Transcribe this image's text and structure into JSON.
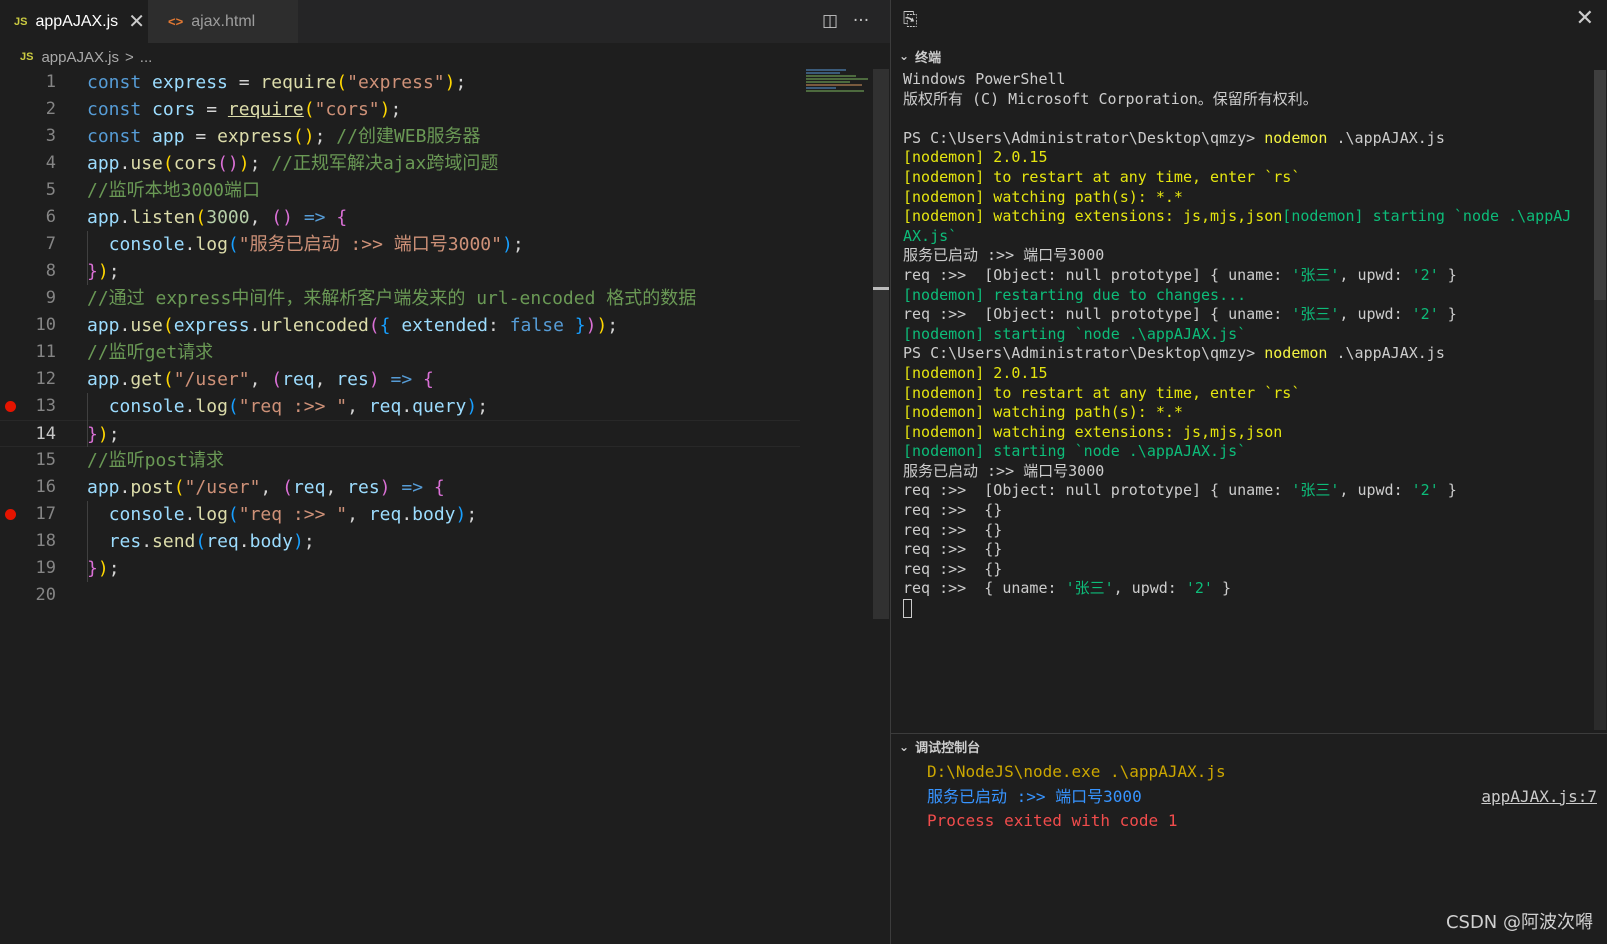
{
  "tabs": [
    {
      "icon": "JS",
      "label": "appAJAX.js",
      "close": "✕"
    },
    {
      "icon": "<>",
      "label": "ajax.html"
    }
  ],
  "editor_actions": {
    "split": "◫",
    "more": "···"
  },
  "breadcrumb": {
    "icon": "JS",
    "file": "appAJAX.js",
    "sep": ">",
    "rest": "..."
  },
  "code": {
    "current_line": 14,
    "breakpoints": [
      13,
      17
    ],
    "lines": [
      [
        [
          "k",
          "const "
        ],
        [
          "v",
          "express"
        ],
        [
          "p",
          " = "
        ],
        [
          "f",
          "require"
        ],
        [
          "b1",
          "("
        ],
        [
          "s",
          "\"express\""
        ],
        [
          "b1",
          ")"
        ],
        [
          "p",
          ";"
        ]
      ],
      [
        [
          "k",
          "const "
        ],
        [
          "v",
          "cors"
        ],
        [
          "p",
          " = "
        ],
        [
          "f u",
          "require"
        ],
        [
          "b1",
          "("
        ],
        [
          "s",
          "\"cors\""
        ],
        [
          "b1",
          ")"
        ],
        [
          "p",
          ";"
        ]
      ],
      [
        [
          "k",
          "const "
        ],
        [
          "v",
          "app"
        ],
        [
          "p",
          " = "
        ],
        [
          "f",
          "express"
        ],
        [
          "b1",
          "()"
        ],
        [
          "p",
          "; "
        ],
        [
          "c",
          "//创建WEB服务器"
        ]
      ],
      [
        [
          "v",
          "app"
        ],
        [
          "p",
          "."
        ],
        [
          "f",
          "use"
        ],
        [
          "b1",
          "("
        ],
        [
          "f",
          "cors"
        ],
        [
          "b2",
          "()"
        ],
        [
          "b1",
          ")"
        ],
        [
          "p",
          "; "
        ],
        [
          "c",
          "//正规军解决ajax跨域问题"
        ]
      ],
      [
        [
          "c",
          "//监听本地3000端口"
        ]
      ],
      [
        [
          "v",
          "app"
        ],
        [
          "p",
          "."
        ],
        [
          "f",
          "listen"
        ],
        [
          "b1",
          "("
        ],
        [
          "n",
          "3000"
        ],
        [
          "p",
          ", "
        ],
        [
          "b2",
          "()"
        ],
        [
          "p",
          " "
        ],
        [
          "k",
          "=>"
        ],
        [
          "p",
          " "
        ],
        [
          "b2",
          "{"
        ]
      ],
      [
        [
          "p",
          "  "
        ],
        [
          "v",
          "console"
        ],
        [
          "p",
          "."
        ],
        [
          "f",
          "log"
        ],
        [
          "b3",
          "("
        ],
        [
          "s",
          "\"服务已启动 :>> 端口号3000\""
        ],
        [
          "b3",
          ")"
        ],
        [
          "p",
          ";"
        ]
      ],
      [
        [
          "b2",
          "}"
        ],
        [
          "b1",
          ")"
        ],
        [
          "p",
          ";"
        ]
      ],
      [
        [
          "c",
          "//通过 express中间件，来解析客户端发来的 url-encoded 格式的数据"
        ]
      ],
      [
        [
          "v",
          "app"
        ],
        [
          "p",
          "."
        ],
        [
          "f",
          "use"
        ],
        [
          "b1",
          "("
        ],
        [
          "v",
          "express"
        ],
        [
          "p",
          "."
        ],
        [
          "f",
          "urlencoded"
        ],
        [
          "b2",
          "("
        ],
        [
          "b3",
          "{"
        ],
        [
          "p",
          " "
        ],
        [
          "v",
          "extended"
        ],
        [
          "p",
          ": "
        ],
        [
          "k",
          "false"
        ],
        [
          "p",
          " "
        ],
        [
          "b3",
          "}"
        ],
        [
          "b2",
          ")"
        ],
        [
          "b1",
          ")"
        ],
        [
          "p",
          ";"
        ]
      ],
      [
        [
          "c",
          "//监听get请求"
        ]
      ],
      [
        [
          "v",
          "app"
        ],
        [
          "p",
          "."
        ],
        [
          "f",
          "get"
        ],
        [
          "b1",
          "("
        ],
        [
          "s",
          "\"/user\""
        ],
        [
          "p",
          ", "
        ],
        [
          "b2",
          "("
        ],
        [
          "v",
          "req"
        ],
        [
          "p",
          ", "
        ],
        [
          "v",
          "res"
        ],
        [
          "b2",
          ")"
        ],
        [
          "p",
          " "
        ],
        [
          "k",
          "=>"
        ],
        [
          "p",
          " "
        ],
        [
          "b2",
          "{"
        ]
      ],
      [
        [
          "p",
          "  "
        ],
        [
          "v",
          "console"
        ],
        [
          "p",
          "."
        ],
        [
          "f",
          "log"
        ],
        [
          "b3",
          "("
        ],
        [
          "s",
          "\"req :>> \""
        ],
        [
          "p",
          ", "
        ],
        [
          "v",
          "req"
        ],
        [
          "p",
          "."
        ],
        [
          "v",
          "query"
        ],
        [
          "b3",
          ")"
        ],
        [
          "p",
          ";"
        ]
      ],
      [
        [
          "b2",
          "}"
        ],
        [
          "b1",
          ")"
        ],
        [
          "p",
          ";"
        ]
      ],
      [
        [
          "c",
          "//监听post请求"
        ]
      ],
      [
        [
          "v",
          "app"
        ],
        [
          "p",
          "."
        ],
        [
          "f",
          "post"
        ],
        [
          "b1",
          "("
        ],
        [
          "s",
          "\"/user\""
        ],
        [
          "p",
          ", "
        ],
        [
          "b2",
          "("
        ],
        [
          "v",
          "req"
        ],
        [
          "p",
          ", "
        ],
        [
          "v",
          "res"
        ],
        [
          "b2",
          ")"
        ],
        [
          "p",
          " "
        ],
        [
          "k",
          "=>"
        ],
        [
          "p",
          " "
        ],
        [
          "b2",
          "{"
        ]
      ],
      [
        [
          "p",
          "  "
        ],
        [
          "v",
          "console"
        ],
        [
          "p",
          "."
        ],
        [
          "f",
          "log"
        ],
        [
          "b3",
          "("
        ],
        [
          "s",
          "\"req :>> \""
        ],
        [
          "p",
          ", "
        ],
        [
          "v",
          "req"
        ],
        [
          "p",
          "."
        ],
        [
          "v",
          "body"
        ],
        [
          "b3",
          ")"
        ],
        [
          "p",
          ";"
        ]
      ],
      [
        [
          "p",
          "  "
        ],
        [
          "v",
          "res"
        ],
        [
          "p",
          "."
        ],
        [
          "f",
          "send"
        ],
        [
          "b3",
          "("
        ],
        [
          "v",
          "req"
        ],
        [
          "p",
          "."
        ],
        [
          "v",
          "body"
        ],
        [
          "b3",
          ")"
        ],
        [
          "p",
          ";"
        ]
      ],
      [
        [
          "b2",
          "}"
        ],
        [
          "b1",
          ")"
        ],
        [
          "p",
          ";"
        ]
      ],
      []
    ]
  },
  "panel": {
    "terminal_title": "终端",
    "debug_title": "调试控制台",
    "close": "✕"
  },
  "terminal_lines": [
    [
      [
        "t-def",
        "Windows PowerShell"
      ]
    ],
    [
      [
        "t-def",
        "版权所有 (C) Microsoft Corporation。保留所有权利。"
      ]
    ],
    [],
    [
      [
        "t-def",
        "PS C:\\Users\\Administrator\\Desktop\\qmzy> "
      ],
      [
        "t-y2",
        "nodemon"
      ],
      [
        "t-def",
        " .\\appAJAX.js"
      ]
    ],
    [
      [
        "t-y",
        "[nodemon] 2.0.15"
      ]
    ],
    [
      [
        "t-y",
        "[nodemon] to restart at any time, enter `rs`"
      ]
    ],
    [
      [
        "t-y",
        "[nodemon] watching path(s): *.*"
      ]
    ],
    [
      [
        "t-y",
        "[nodemon] watching extensions: js,mjs,json"
      ],
      [
        "t-g",
        "[nodemon] starting `node .\\appAJ"
      ]
    ],
    [
      [
        "t-g",
        "AX.js`"
      ]
    ],
    [
      [
        "t-def",
        "服务已启动 :>> 端口号3000"
      ]
    ],
    [
      [
        "t-def",
        "req :>>  [Object: null prototype] { uname: "
      ],
      [
        "t-g",
        "'张三'"
      ],
      [
        "t-def",
        ", upwd: "
      ],
      [
        "t-g",
        "'2'"
      ],
      [
        "t-def",
        " }"
      ]
    ],
    [
      [
        "t-g",
        "[nodemon] restarting due to changes..."
      ]
    ],
    [
      [
        "t-def",
        "req :>>  [Object: null prototype] { uname: "
      ],
      [
        "t-g",
        "'张三'"
      ],
      [
        "t-def",
        ", upwd: "
      ],
      [
        "t-g",
        "'2'"
      ],
      [
        "t-def",
        " }"
      ]
    ],
    [
      [
        "t-g",
        "[nodemon] starting `node .\\appAJAX.js`"
      ]
    ],
    [
      [
        "t-def",
        "PS C:\\Users\\Administrator\\Desktop\\qmzy> "
      ],
      [
        "t-y2",
        "nodemon"
      ],
      [
        "t-def",
        " .\\appAJAX.js"
      ]
    ],
    [
      [
        "t-y",
        "[nodemon] 2.0.15"
      ]
    ],
    [
      [
        "t-y",
        "[nodemon] to restart at any time, enter `rs`"
      ]
    ],
    [
      [
        "t-y",
        "[nodemon] watching path(s): *.*"
      ]
    ],
    [
      [
        "t-y",
        "[nodemon] watching extensions: js,mjs,json"
      ]
    ],
    [
      [
        "t-g",
        "[nodemon] starting `node .\\appAJAX.js`"
      ]
    ],
    [
      [
        "t-def",
        "服务已启动 :>> 端口号3000"
      ]
    ],
    [
      [
        "t-def",
        "req :>>  [Object: null prototype] { uname: "
      ],
      [
        "t-g",
        "'张三'"
      ],
      [
        "t-def",
        ", upwd: "
      ],
      [
        "t-g",
        "'2'"
      ],
      [
        "t-def",
        " }"
      ]
    ],
    [
      [
        "t-def",
        "req :>>  {}"
      ]
    ],
    [
      [
        "t-def",
        "req :>>  {}"
      ]
    ],
    [
      [
        "t-def",
        "req :>>  {}"
      ]
    ],
    [
      [
        "t-def",
        "req :>>  {}"
      ]
    ],
    [
      [
        "t-def",
        "req :>>  { uname: "
      ],
      [
        "t-g",
        "'张三'"
      ],
      [
        "t-def",
        ", upwd: "
      ],
      [
        "t-g",
        "'2'"
      ],
      [
        "t-def",
        " }"
      ]
    ]
  ],
  "debug_lines": [
    {
      "cls": "d-y",
      "text": "D:\\NodeJS\\node.exe .\\appAJAX.js",
      "src": ""
    },
    {
      "cls": "d-b",
      "text": "服务已启动 :>> 端口号3000",
      "src": "appAJAX.js:7"
    },
    {
      "cls": "d-r",
      "text": "Process exited with code 1",
      "src": ""
    }
  ],
  "watermark": "CSDN @阿波次嘚",
  "colors": {
    "background": "#1e1e1e",
    "breakpoint": "#e51400",
    "keyword": "#569cd6",
    "string": "#ce9178",
    "comment": "#6a9955",
    "nodemon_yellow": "#e5e510",
    "nodemon_green": "#0dbc79"
  }
}
